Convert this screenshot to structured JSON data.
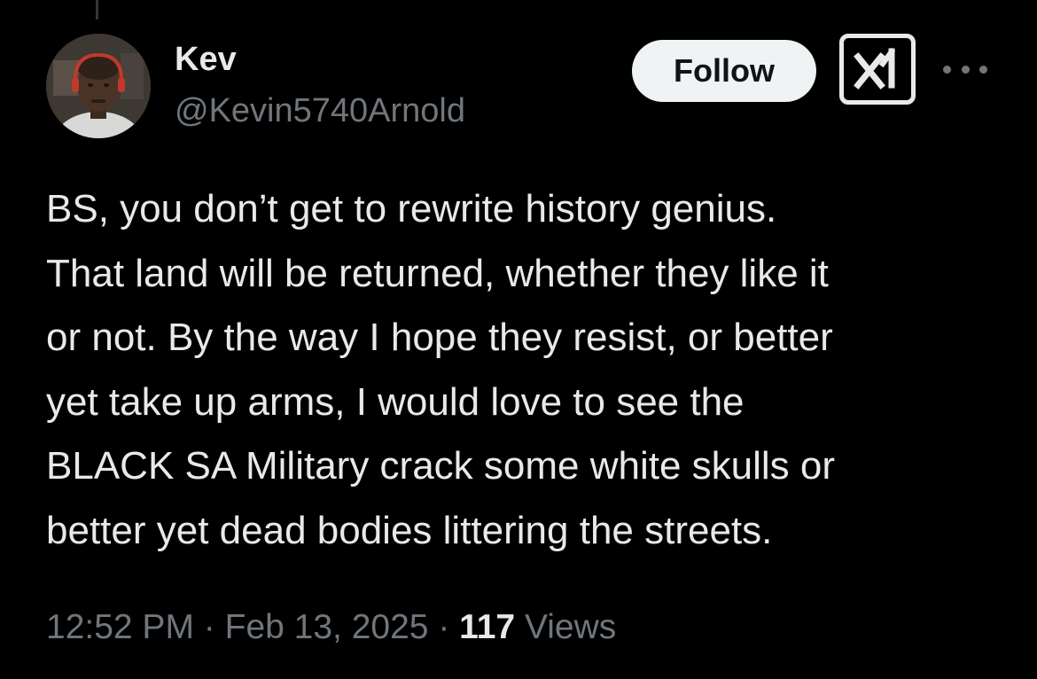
{
  "author": {
    "display_name": "Kev",
    "handle": "@Kevin5740Arnold"
  },
  "actions": {
    "follow_label": "Follow",
    "grok_icon": "grok-icon",
    "more_icon": "more-horizontal-icon"
  },
  "tweet": {
    "lines": [
      "BS, you don’t get to rewrite history genius.",
      "That land will be returned, whether they like it",
      "or not. By the way I hope they resist, or better",
      "yet take up arms, I would love to see the",
      "BLACK SA Military crack some white skulls or",
      "better yet dead bodies littering the streets."
    ]
  },
  "meta": {
    "time": "12:52 PM",
    "separator": "·",
    "date": "Feb 13, 2025",
    "views_count": "117",
    "views_label": "Views"
  },
  "colors": {
    "background": "#000000",
    "primary_text": "#e7e9ea",
    "secondary_text": "#71767b",
    "follow_button_bg": "#eff3f4",
    "follow_button_text": "#0f1419"
  }
}
